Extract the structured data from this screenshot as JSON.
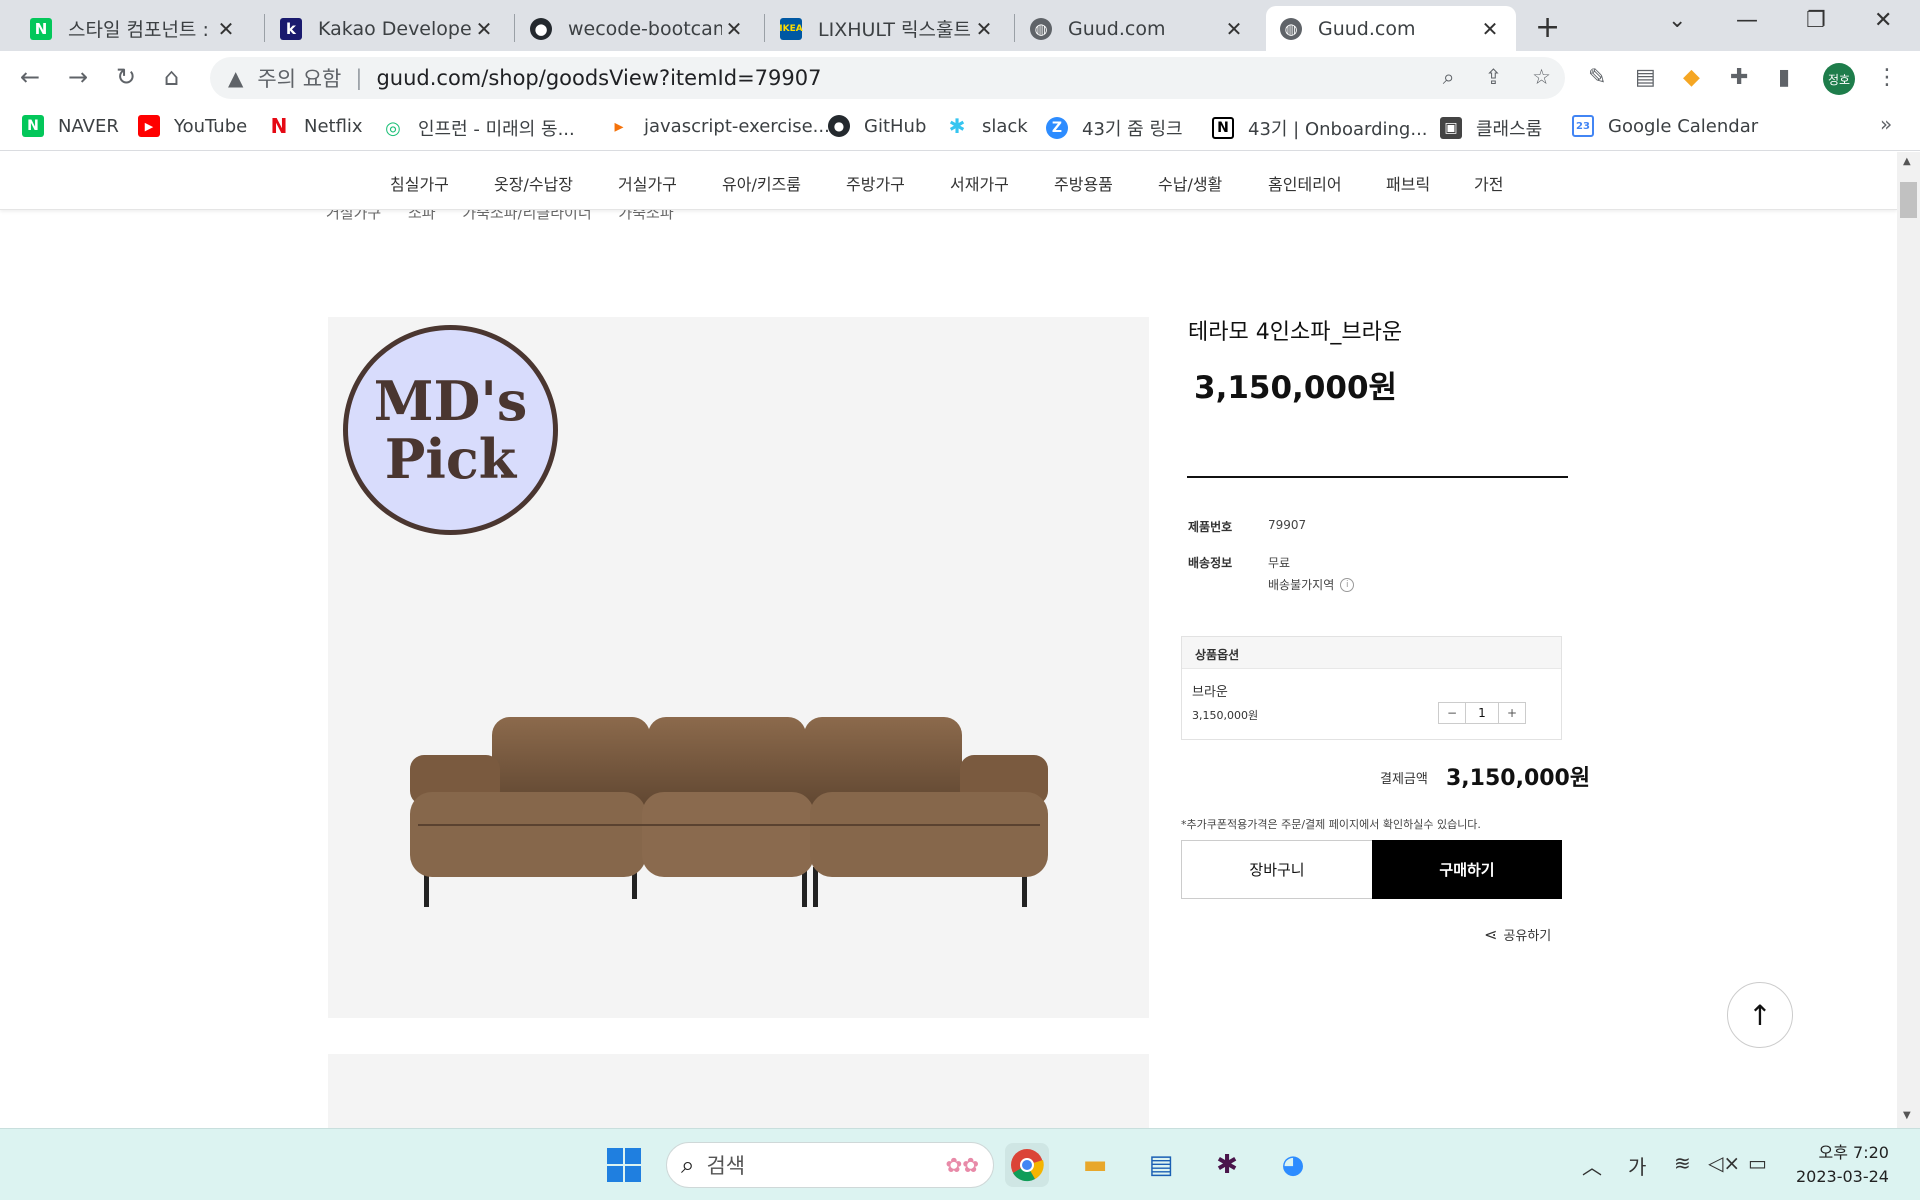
{
  "browser": {
    "tabs": [
      {
        "title": "스타일 컴포넌트 : ",
        "favicon": "N",
        "color": "#03c75a"
      },
      {
        "title": "Kakao Developers",
        "favicon": "k",
        "color": "#1a1a6e"
      },
      {
        "title": "wecode-bootcamp",
        "favicon": "github-icon",
        "color": "#24292e"
      },
      {
        "title": "LIXHULT 릭스훌트",
        "favicon": "IKEA",
        "color": "#0058a3"
      },
      {
        "title": "Guud.com",
        "favicon": "globe-icon",
        "color": "#5f6368"
      },
      {
        "title": "Guud.com",
        "favicon": "globe-icon",
        "color": "#5f6368"
      }
    ],
    "address": {
      "security_label": "주의 요함",
      "url": "guud.com/shop/goodsView?itemId=79907"
    },
    "profile_initials": "정호",
    "bookmarks": [
      {
        "label": "NAVER",
        "icon": "N",
        "color": "#03c75a"
      },
      {
        "label": "YouTube",
        "icon": "▶",
        "color": "#ff0000"
      },
      {
        "label": "Netflix",
        "icon": "N",
        "color": "#e50914"
      },
      {
        "label": "인프런 - 미래의 동...",
        "icon": "◎",
        "color": "#1dc078"
      },
      {
        "label": "javascript-exercise...",
        "icon": "▸",
        "color": "#f5720a"
      },
      {
        "label": "GitHub",
        "icon": "●",
        "color": "#24292e"
      },
      {
        "label": "slack",
        "icon": "✱",
        "color": "#4a154b"
      },
      {
        "label": "43기 줌 링크",
        "icon": "Z",
        "color": "#2d8cff"
      },
      {
        "label": "43기 | Onboarding...",
        "icon": "N",
        "color": "#000000"
      },
      {
        "label": "클래스룸",
        "icon": "▣",
        "color": "#444444"
      },
      {
        "label": "Google Calendar",
        "icon": "23",
        "color": "#4285f4"
      }
    ]
  },
  "site": {
    "categories": [
      "침실가구",
      "옷장/수납장",
      "거실가구",
      "유아/키즈룸",
      "주방가구",
      "서재가구",
      "주방용품",
      "수납/생활",
      "홈인테리어",
      "패브릭",
      "가전"
    ],
    "breadcrumbs": [
      "거실가구",
      "소파",
      "가죽소파/리클라이너",
      "가죽소파"
    ]
  },
  "product": {
    "badge_line1": "MD's",
    "badge_line2": "Pick",
    "title": "테라모 4인소파_브라운",
    "price": "3,150,000원",
    "info": [
      {
        "label": "제품번호",
        "value": "79907"
      },
      {
        "label": "배송정보",
        "value": "무료"
      }
    ],
    "delivery_note": "배송불가지역",
    "option_header": "상품옵션",
    "option_name": "브라운",
    "option_price": "3,150,000원",
    "quantity": "1",
    "total_label": "결제금액",
    "total_value": "3,150,000원",
    "coupon_note": "*추가쿠폰적용가격은 주문/결제 페이지에서 확인하실수 있습니다.",
    "cart_label": "장바구니",
    "buy_label": "구매하기",
    "share_label": "공유하기"
  },
  "taskbar": {
    "search_placeholder": "검색",
    "time": "오후 7:20",
    "date": "2023-03-24",
    "ime": "가"
  }
}
